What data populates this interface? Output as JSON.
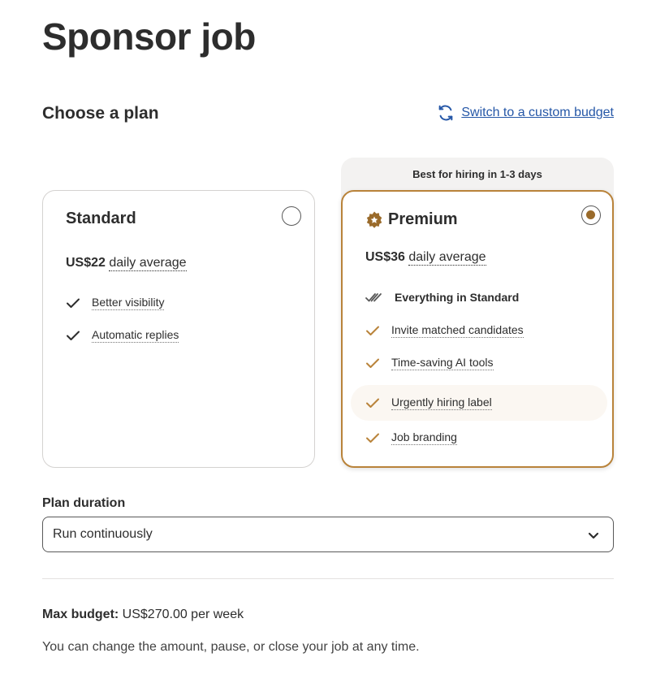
{
  "page": {
    "title": "Sponsor job"
  },
  "section": {
    "title": "Choose a plan",
    "custom_budget_link": "Switch to a custom budget"
  },
  "plans": {
    "standard": {
      "name": "Standard",
      "price": "US$22",
      "price_suffix": "daily average",
      "selected": false,
      "features": [
        "Better visibility",
        "Automatic replies"
      ]
    },
    "premium": {
      "banner": "Best for hiring in 1-3 days",
      "name": "Premium",
      "price": "US$36",
      "price_suffix": "daily average",
      "selected": true,
      "features": [
        "Everything in Standard",
        "Invite matched candidates",
        "Time-saving AI tools",
        "Urgently hiring label",
        "Job branding"
      ]
    }
  },
  "duration": {
    "label": "Plan duration",
    "selected": "Run continuously"
  },
  "budget": {
    "label": "Max budget:",
    "value": "US$270.00 per week",
    "note": "You can change the amount, pause, or close your job at any time."
  },
  "colors": {
    "link": "#2557a7",
    "premium_accent": "#b9833a",
    "text": "#2d2d2d"
  }
}
